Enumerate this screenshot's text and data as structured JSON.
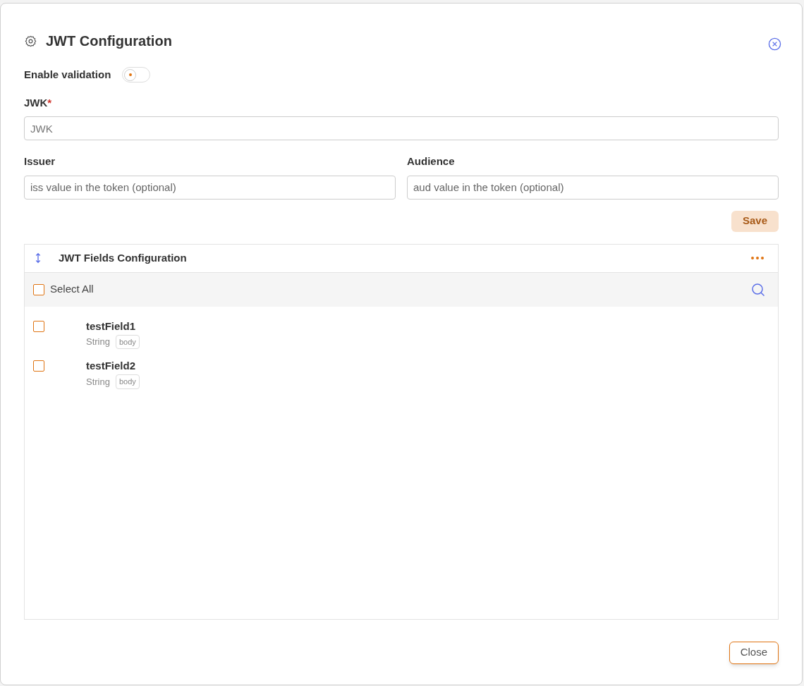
{
  "dialog": {
    "title": "JWT Configuration"
  },
  "enable_validation": {
    "label": "Enable validation",
    "on": false
  },
  "jwk": {
    "label": "JWK",
    "required_mark": "*",
    "placeholder": "JWK"
  },
  "issuer": {
    "label": "Issuer",
    "placeholder": "iss value in the token (optional)"
  },
  "audience": {
    "label": "Audience",
    "placeholder": "aud value in the token (optional)"
  },
  "save_button": {
    "label": "Save",
    "disabled": true
  },
  "fields_panel": {
    "title": "JWT Fields Configuration",
    "select_all": {
      "label": "Select All",
      "checked": false
    },
    "items": [
      {
        "name": "testField1",
        "type": "String",
        "tag": "body",
        "checked": false
      },
      {
        "name": "testField2",
        "type": "String",
        "tag": "body",
        "checked": false
      }
    ]
  },
  "close_button": {
    "label": "Close"
  }
}
